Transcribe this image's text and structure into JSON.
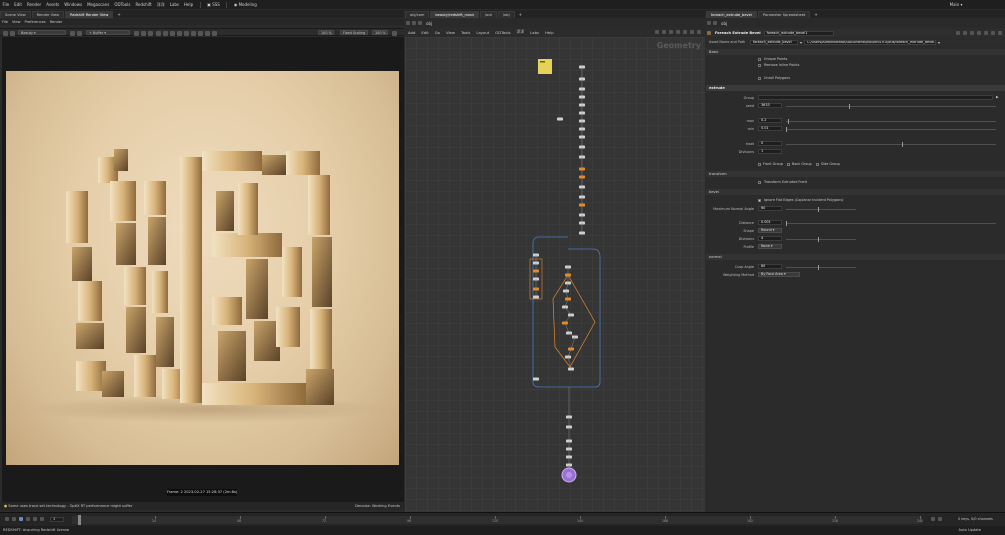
{
  "menubar": {
    "items": [
      "File",
      "Edit",
      "Render",
      "Assets",
      "Windows",
      "Megascans",
      "ODTools",
      "Redshift",
      "洋洋",
      "Labs",
      "Help"
    ],
    "desk_label": "SSS",
    "workspace_label": "Modeling",
    "right_label": "Main"
  },
  "left_panel": {
    "tabs": [
      "Scene View",
      "Render View",
      "Redshift Render View"
    ],
    "menu": [
      "File",
      "View",
      "Preferences",
      "Render"
    ],
    "toolbar": {
      "snapshot_label": "Beauty",
      "aov_label": "+ Buffer",
      "zoom1": "100 %",
      "fixed_scaling": "Fixed Scaling",
      "zoom2": "100 %"
    },
    "frame_info": "Frame: 2  2023-02-27  15:28:37  (2m:8s)",
    "status_left": "Some uses trace set technology - OptiX RT performance might suffer",
    "status_right": "Denoise: Working Events"
  },
  "network_panel": {
    "tabs": [
      "obj/cam",
      "beauty/redshift_rsrod",
      "/out",
      "/obj"
    ],
    "path": "obj",
    "menu": [
      "Add",
      "Edit",
      "Go",
      "View",
      "Tools",
      "Layout",
      "ODTools",
      "洋洋",
      "Labs",
      "Help"
    ],
    "context_label": "Geometry"
  },
  "param_panel": {
    "tabs": [
      "foreach_extrude_bevel",
      "Parameter Spreadsheet"
    ],
    "path": "obj",
    "node_type": "Foreach Extrude Bevel",
    "node_name": "foreach_extrude_bevel1",
    "asset_name_label": "Asset Name and Path",
    "asset_name": "foreach_extrude_bevel",
    "asset_path": "C:/Users/Administrator/Documents/houdini19.0/otls/foreach_extrude_bevel.hda",
    "sections": {
      "basic": "Basic",
      "extrude": "extrude",
      "transform": "transform",
      "bevel": "bevel",
      "normal": "normal"
    },
    "basic": {
      "unique_points": "Unique Points",
      "remove_inline": "Remove Inline Points",
      "unroll_polygons": "Unroll Polygons"
    },
    "extrude": {
      "group_label": "Group",
      "seed_label": "seed",
      "seed_value": "3633",
      "max_label": "max",
      "max_value": "0.2",
      "min_label": "min",
      "min_value": "0.01",
      "inset_label": "Inset",
      "inset_value": "0",
      "divisions_label": "Divisions",
      "divisions_value": "1",
      "front_group": "Front Group",
      "back_group": "Back Group",
      "side_group": "Side Group"
    },
    "transform": {
      "transform_extruded": "Transform Extruded Front"
    },
    "bevel": {
      "ignore_flat": "Ignore Flat Edges (Coplanar Incident Polygons)",
      "max_angle_label": "Maximum Normal Angle",
      "max_angle_value": "60",
      "distance_label": "Distance",
      "distance_value": "0.001",
      "shape_label": "Shape",
      "shape_value": "Round",
      "divisions_label": "Divisions",
      "divisions_value": "4",
      "profile_label": "Profile",
      "profile_value": "None"
    },
    "normal": {
      "cusp_label": "Cusp Angle",
      "cusp_value": "60",
      "weighting_label": "Weighting Method",
      "weighting_value": "By Face Area"
    }
  },
  "timeline": {
    "frame_field": "1",
    "ticks": [
      "24",
      "48",
      "72",
      "96",
      "120",
      "144",
      "168",
      "192",
      "216",
      "240"
    ],
    "end_frame": "240",
    "keys_label": "0 keys, 0/0 channels",
    "autoupdate": "Auto Update"
  },
  "statusbar": {
    "text": "REDSHIFT: Acquiring Redshift license"
  },
  "colors": {
    "accent": "#e58b2a",
    "selected_node": "#9b6fd3",
    "sticky_note": "#e6d25a",
    "background": "#2b2b2b"
  }
}
